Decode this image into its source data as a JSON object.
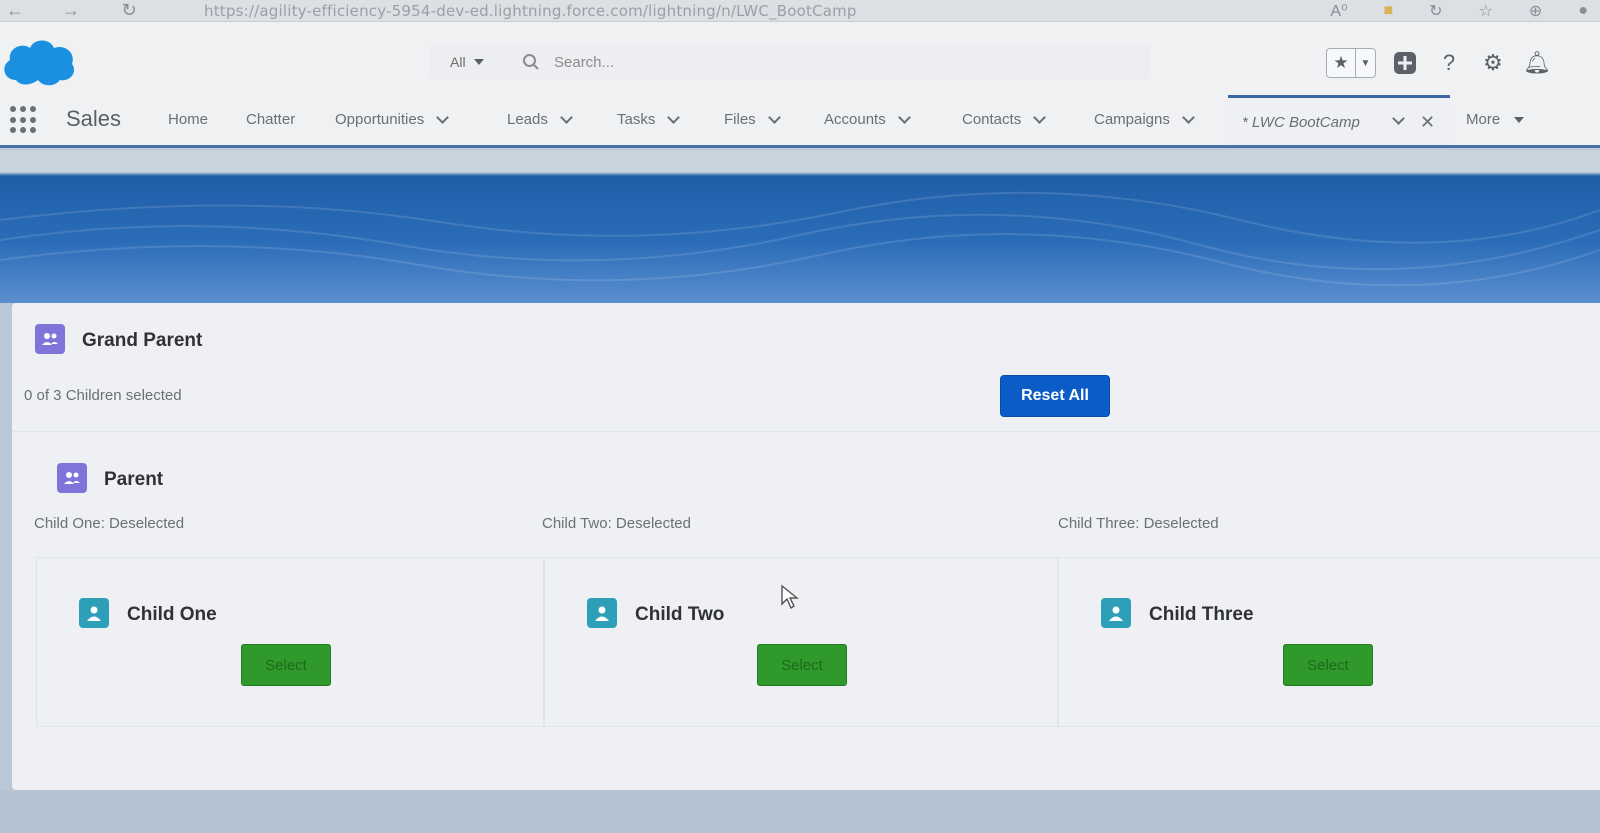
{
  "browser": {
    "url": "https://agility-efficiency-5954-dev-ed.lightning.force.com/lightning/n/LWC_BootCamp"
  },
  "header": {
    "search_scope": "All",
    "search_placeholder": "Search..."
  },
  "nav": {
    "app_name": "Sales",
    "items": [
      {
        "label": "Home"
      },
      {
        "label": "Chatter"
      },
      {
        "label": "Opportunities"
      },
      {
        "label": "Leads"
      },
      {
        "label": "Tasks"
      },
      {
        "label": "Files"
      },
      {
        "label": "Accounts"
      },
      {
        "label": "Contacts"
      },
      {
        "label": "Campaigns"
      }
    ],
    "active_tab": "* LWC BootCamp",
    "more_label": "More"
  },
  "grand_parent": {
    "title": "Grand Parent",
    "summary": "0 of 3 Children selected",
    "reset_label": "Reset All"
  },
  "parent": {
    "title": "Parent",
    "statuses": [
      "Child One: Deselected",
      "Child Two: Deselected",
      "Child Three: Deselected"
    ]
  },
  "children": [
    {
      "title": "Child One",
      "button": "Select"
    },
    {
      "title": "Child Two",
      "button": "Select"
    },
    {
      "title": "Child Three",
      "button": "Select"
    }
  ],
  "colors": {
    "brand_blue": "#0b5cc7",
    "select_green": "#2f9a2b",
    "group_icon": "#7f74d9",
    "user_icon": "#2e9fb8"
  }
}
